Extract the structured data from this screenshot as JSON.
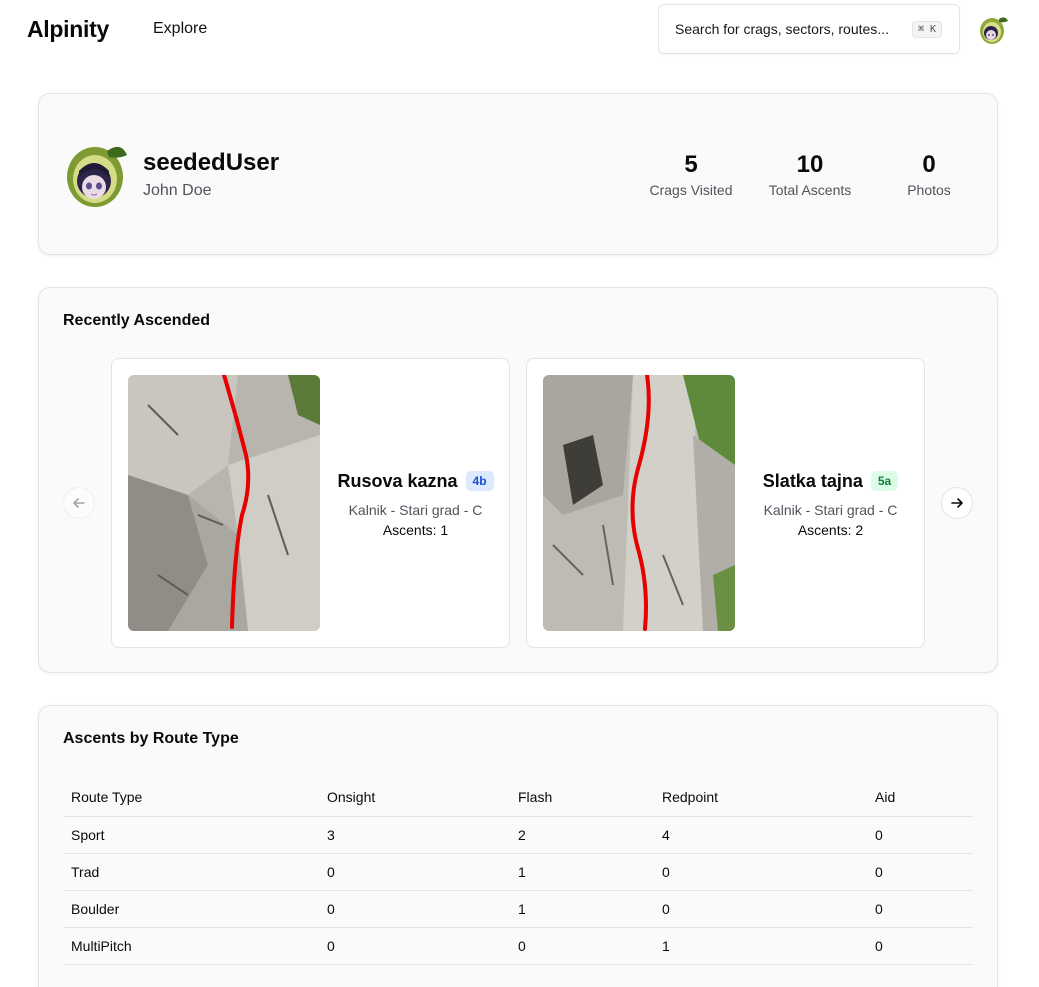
{
  "header": {
    "logo": "Alpinity",
    "nav_explore": "Explore",
    "search_placeholder": "Search for crags, sectors, routes...",
    "search_shortcut": "⌘ K"
  },
  "profile": {
    "username": "seededUser",
    "full_name": "John Doe",
    "stats": [
      {
        "value": "5",
        "label": "Crags Visited"
      },
      {
        "value": "10",
        "label": "Total Ascents"
      },
      {
        "value": "0",
        "label": "Photos"
      }
    ]
  },
  "recent": {
    "title": "Recently Ascended",
    "routes": [
      {
        "name": "Rusova kazna",
        "grade": "4b",
        "grade_color": "#1d4ed8",
        "location": "Kalnik - Stari grad - C",
        "ascents": "Ascents: 1"
      },
      {
        "name": "Slatka tajna",
        "grade": "5a",
        "grade_color": "#15803d",
        "location": "Kalnik - Stari grad - C",
        "ascents": "Ascents: 2"
      }
    ]
  },
  "ascents_table": {
    "title": "Ascents by Route Type",
    "columns": [
      "Route Type",
      "Onsight",
      "Flash",
      "Redpoint",
      "Aid"
    ],
    "rows": [
      [
        "Sport",
        "3",
        "2",
        "4",
        "0"
      ],
      [
        "Trad",
        "0",
        "1",
        "0",
        "0"
      ],
      [
        "Boulder",
        "0",
        "1",
        "0",
        "0"
      ],
      [
        "MultiPitch",
        "0",
        "0",
        "1",
        "0"
      ]
    ]
  }
}
